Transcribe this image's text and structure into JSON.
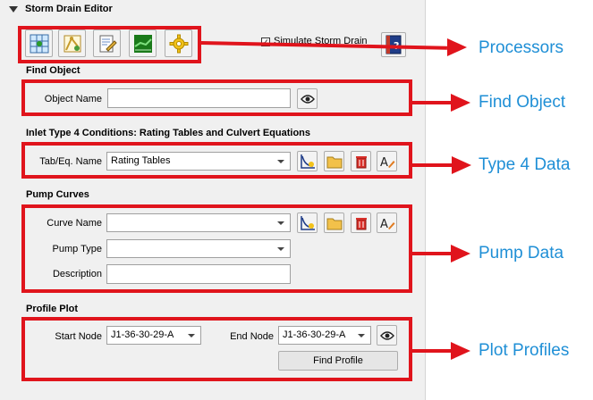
{
  "panel": {
    "title": "Storm Drain Editor",
    "simulate_label": "Simulate Storm Drain",
    "simulate_checked": true
  },
  "toolbar": {
    "icons": [
      "grid-icon",
      "node-pen-icon",
      "edit-icon",
      "profile-chart-icon",
      "gear-icon"
    ],
    "help_icon": "help-book-icon"
  },
  "find_object": {
    "title": "Find Object",
    "name_label": "Object Name",
    "name_value": "",
    "find_icon": "eye-icon"
  },
  "type4": {
    "title": "Inlet Type 4 Conditions: Rating Tables and Culvert Equations",
    "name_label": "Tab/Eq. Name",
    "selected": "Rating Tables"
  },
  "pump": {
    "title": "Pump Curves",
    "curve_label": "Curve Name",
    "curve_value": "",
    "type_label": "Pump Type",
    "type_value": "",
    "description_label": "Description",
    "description_value": ""
  },
  "profile": {
    "title": "Profile Plot",
    "start_label": "Start Node",
    "start_value": "J1-36-30-29-A",
    "end_label": "End Node",
    "end_value": "J1-36-30-29-A",
    "find_button": "Find Profile"
  },
  "callouts": {
    "processors": "Processors",
    "find_object": "Find Object",
    "type4": "Type 4 Data",
    "pump": "Pump Data",
    "plot": "Plot Profiles"
  },
  "colors": {
    "annotation_red": "#e0141c",
    "callout_blue": "#1f8fd6"
  }
}
